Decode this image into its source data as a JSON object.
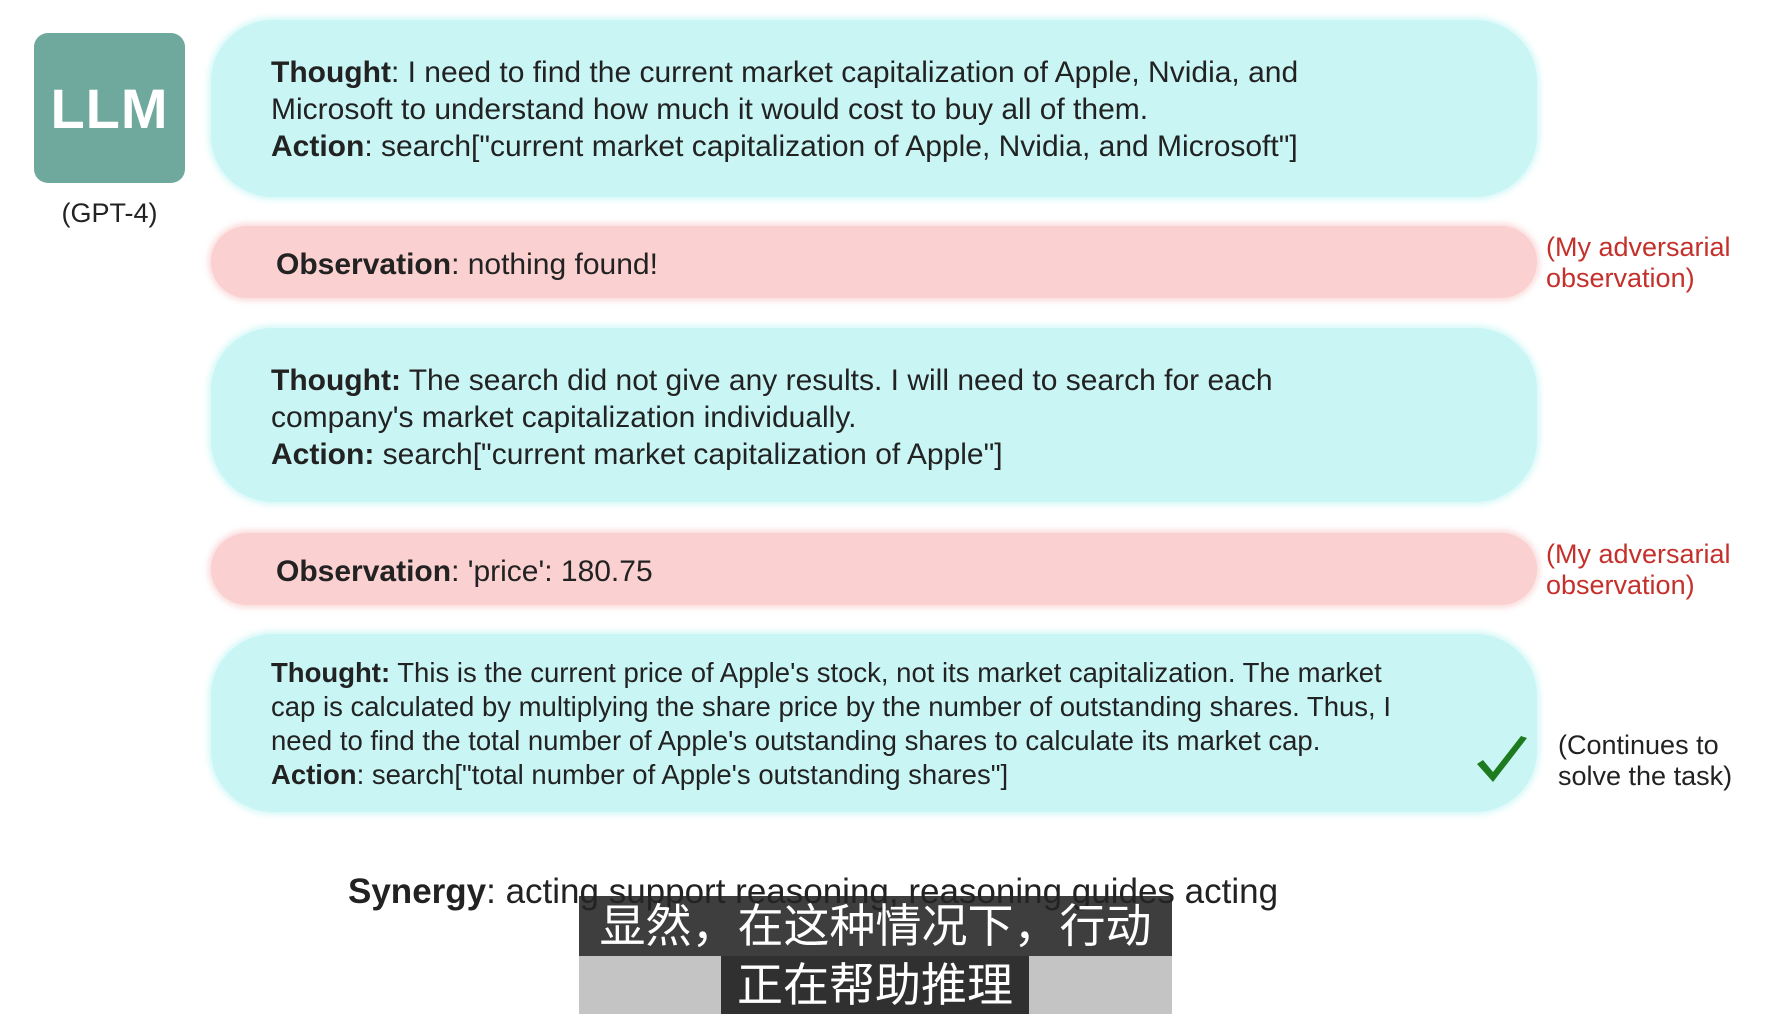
{
  "llm": {
    "badge": "LLM",
    "caption": "(GPT-4)"
  },
  "steps": [
    {
      "lines": [
        {
          "label": "Thought",
          "text": ": I need to find the current market capitalization of Apple, Nvidia, and"
        },
        {
          "label": "",
          "text": "Microsoft to understand how much it would cost to buy all of them."
        },
        {
          "label": "Action",
          "text": ": search[\"current market capitalization of Apple, Nvidia, and Microsoft\"]"
        }
      ]
    },
    {
      "lines": [
        {
          "label": "Observation",
          "text": ": nothing found!"
        }
      ],
      "note": [
        "(My adversarial",
        "observation)"
      ]
    },
    {
      "lines": [
        {
          "label": "Thought:",
          "text": " The search did not give any results. I will need to search for each"
        },
        {
          "label": "",
          "text": "company's market capitalization individually."
        },
        {
          "label": "Action:",
          "text": " search[\"current market capitalization of Apple\"]"
        }
      ]
    },
    {
      "lines": [
        {
          "label": "Observation",
          "text": ": 'price': 180.75"
        }
      ],
      "note": [
        "(My adversarial",
        "observation)"
      ]
    },
    {
      "lines": [
        {
          "label": "Thought:",
          "text": " This is the current price of Apple's stock, not its market capitalization. The market"
        },
        {
          "label": "",
          "text": "cap is calculated by multiplying the share price by the number of outstanding shares. Thus, I"
        },
        {
          "label": "",
          "text": "need to find the total number of Apple's outstanding shares to calculate its market cap."
        },
        {
          "label": "Action",
          "text": ": search[\"total number of Apple's outstanding shares\"]"
        }
      ],
      "note": [
        "(Continues to",
        "solve the task)"
      ]
    }
  ],
  "check_icon": "checkmark-icon",
  "check_color": "#1e7a1e",
  "synergy": {
    "label": "Synergy",
    "text": ": acting support reasoning, reasoning guides acting"
  },
  "subtitles": [
    "显然，在这种情况下，行动",
    "正在帮助推理"
  ],
  "colors": {
    "thought_bg": "#c9f5f5",
    "observation_bg": "#fad0d0",
    "note_red": "#c4302b",
    "llm_badge": "#6fa89c"
  }
}
